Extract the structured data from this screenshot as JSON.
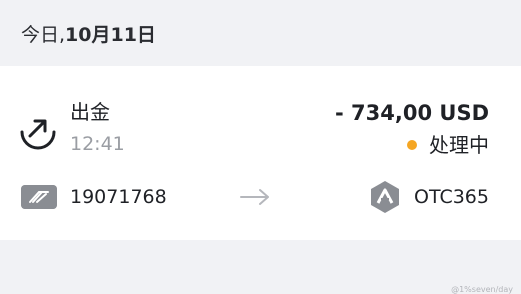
{
  "date_header": {
    "prefix": "今日, ",
    "date": "10月11日"
  },
  "transaction": {
    "title": "出金",
    "time": "12:41",
    "amount": "- 734,00 USD",
    "status": "处理中",
    "status_color": "#f5a623",
    "from_account": "19071768",
    "to_name": "OTC365",
    "icon": "withdraw-arrow-icon"
  },
  "watermark": "@1%seven/day"
}
